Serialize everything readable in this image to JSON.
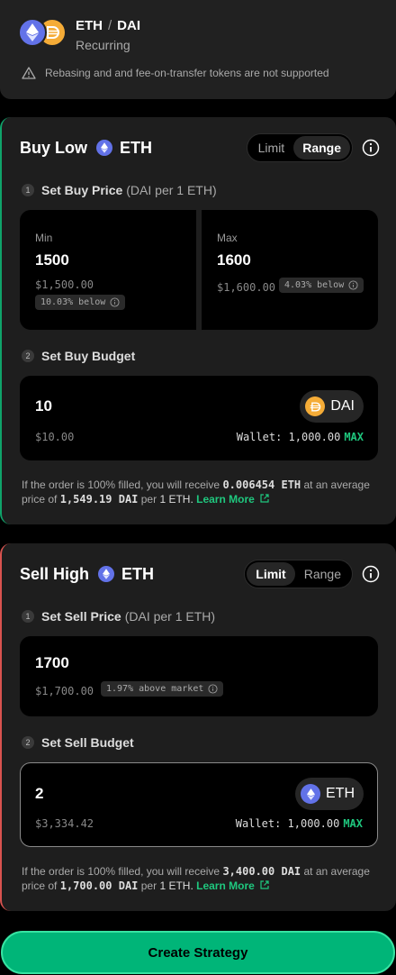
{
  "pair": {
    "base": "ETH",
    "quote": "DAI",
    "separator": "/",
    "subtitle": "Recurring",
    "warning": "Rebasing and and fee-on-transfer tokens are not supported"
  },
  "buy": {
    "title": "Buy Low",
    "token": "ETH",
    "mode_options": [
      "Limit",
      "Range"
    ],
    "active_mode": "Range",
    "step1_label": "Set Buy Price",
    "step1_paren": "(DAI per 1 ETH)",
    "min": {
      "label": "Min",
      "value": "1500",
      "usd": "$1,500.00",
      "chip": "10.03% below"
    },
    "max": {
      "label": "Max",
      "value": "1600",
      "usd": "$1,600.00",
      "chip": "4.03% below"
    },
    "step2_label": "Set Buy Budget",
    "budget": {
      "value": "10",
      "usd": "$10.00",
      "token": "DAI",
      "wallet": "Wallet: 1,000.00",
      "max": "MAX"
    },
    "note": {
      "prefix": "If the order is 100% filled, you will receive",
      "amount": "0.006454 ETH",
      "mid": "at an average price of",
      "price": "1,549.19 DAI",
      "per": "per",
      "unit": "1 ETH.",
      "learn": "Learn More"
    }
  },
  "sell": {
    "title": "Sell High",
    "token": "ETH",
    "mode_options": [
      "Limit",
      "Range"
    ],
    "active_mode": "Limit",
    "step1_label": "Set Sell Price",
    "step1_paren": "(DAI per 1 ETH)",
    "price": {
      "value": "1700",
      "usd": "$1,700.00",
      "chip": "1.97% above market"
    },
    "step2_label": "Set Sell Budget",
    "budget": {
      "value": "2",
      "usd": "$3,334.42",
      "token": "ETH",
      "wallet": "Wallet: 1,000.00",
      "max": "MAX"
    },
    "note": {
      "prefix": "If the order is 100% filled, you will receive",
      "amount": "3,400.00 DAI",
      "mid": "at an average price of",
      "price": "1,700.00 DAI",
      "per": "per",
      "unit": "1 ETH.",
      "learn": "Learn More"
    }
  },
  "cta": {
    "label": "Create Strategy"
  },
  "colors": {
    "accent": "#00b578",
    "buy_border": "#0fa36a",
    "sell_border": "#d9534f",
    "max": "#1fc77e"
  },
  "icons": [
    "eth-icon",
    "dai-icon",
    "warning-icon",
    "info-icon",
    "external-link-icon"
  ]
}
